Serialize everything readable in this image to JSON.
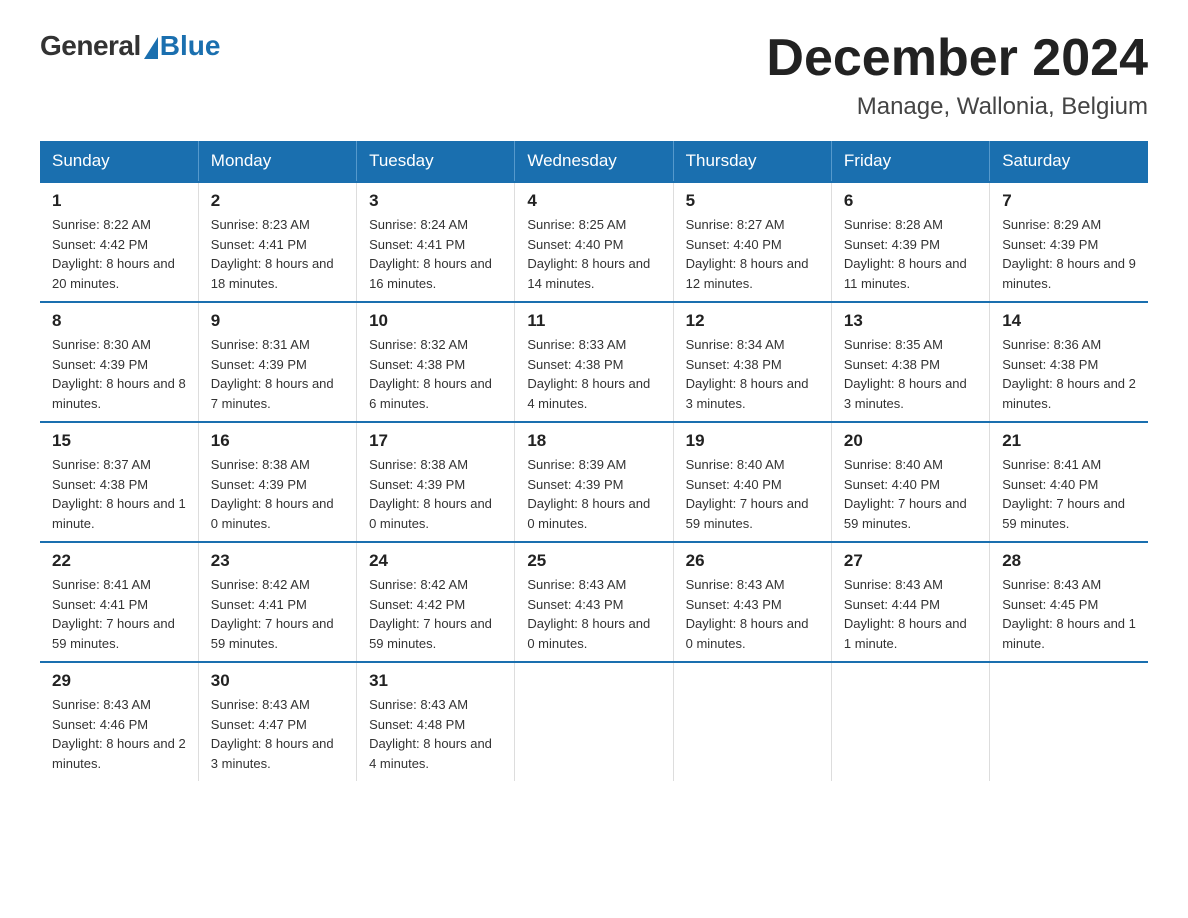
{
  "logo": {
    "general": "General",
    "blue": "Blue"
  },
  "title": "December 2024",
  "location": "Manage, Wallonia, Belgium",
  "days_of_week": [
    "Sunday",
    "Monday",
    "Tuesday",
    "Wednesday",
    "Thursday",
    "Friday",
    "Saturday"
  ],
  "weeks": [
    [
      {
        "day": "1",
        "sunrise": "8:22 AM",
        "sunset": "4:42 PM",
        "daylight": "8 hours and 20 minutes."
      },
      {
        "day": "2",
        "sunrise": "8:23 AM",
        "sunset": "4:41 PM",
        "daylight": "8 hours and 18 minutes."
      },
      {
        "day": "3",
        "sunrise": "8:24 AM",
        "sunset": "4:41 PM",
        "daylight": "8 hours and 16 minutes."
      },
      {
        "day": "4",
        "sunrise": "8:25 AM",
        "sunset": "4:40 PM",
        "daylight": "8 hours and 14 minutes."
      },
      {
        "day": "5",
        "sunrise": "8:27 AM",
        "sunset": "4:40 PM",
        "daylight": "8 hours and 12 minutes."
      },
      {
        "day": "6",
        "sunrise": "8:28 AM",
        "sunset": "4:39 PM",
        "daylight": "8 hours and 11 minutes."
      },
      {
        "day": "7",
        "sunrise": "8:29 AM",
        "sunset": "4:39 PM",
        "daylight": "8 hours and 9 minutes."
      }
    ],
    [
      {
        "day": "8",
        "sunrise": "8:30 AM",
        "sunset": "4:39 PM",
        "daylight": "8 hours and 8 minutes."
      },
      {
        "day": "9",
        "sunrise": "8:31 AM",
        "sunset": "4:39 PM",
        "daylight": "8 hours and 7 minutes."
      },
      {
        "day": "10",
        "sunrise": "8:32 AM",
        "sunset": "4:38 PM",
        "daylight": "8 hours and 6 minutes."
      },
      {
        "day": "11",
        "sunrise": "8:33 AM",
        "sunset": "4:38 PM",
        "daylight": "8 hours and 4 minutes."
      },
      {
        "day": "12",
        "sunrise": "8:34 AM",
        "sunset": "4:38 PM",
        "daylight": "8 hours and 3 minutes."
      },
      {
        "day": "13",
        "sunrise": "8:35 AM",
        "sunset": "4:38 PM",
        "daylight": "8 hours and 3 minutes."
      },
      {
        "day": "14",
        "sunrise": "8:36 AM",
        "sunset": "4:38 PM",
        "daylight": "8 hours and 2 minutes."
      }
    ],
    [
      {
        "day": "15",
        "sunrise": "8:37 AM",
        "sunset": "4:38 PM",
        "daylight": "8 hours and 1 minute."
      },
      {
        "day": "16",
        "sunrise": "8:38 AM",
        "sunset": "4:39 PM",
        "daylight": "8 hours and 0 minutes."
      },
      {
        "day": "17",
        "sunrise": "8:38 AM",
        "sunset": "4:39 PM",
        "daylight": "8 hours and 0 minutes."
      },
      {
        "day": "18",
        "sunrise": "8:39 AM",
        "sunset": "4:39 PM",
        "daylight": "8 hours and 0 minutes."
      },
      {
        "day": "19",
        "sunrise": "8:40 AM",
        "sunset": "4:40 PM",
        "daylight": "7 hours and 59 minutes."
      },
      {
        "day": "20",
        "sunrise": "8:40 AM",
        "sunset": "4:40 PM",
        "daylight": "7 hours and 59 minutes."
      },
      {
        "day": "21",
        "sunrise": "8:41 AM",
        "sunset": "4:40 PM",
        "daylight": "7 hours and 59 minutes."
      }
    ],
    [
      {
        "day": "22",
        "sunrise": "8:41 AM",
        "sunset": "4:41 PM",
        "daylight": "7 hours and 59 minutes."
      },
      {
        "day": "23",
        "sunrise": "8:42 AM",
        "sunset": "4:41 PM",
        "daylight": "7 hours and 59 minutes."
      },
      {
        "day": "24",
        "sunrise": "8:42 AM",
        "sunset": "4:42 PM",
        "daylight": "7 hours and 59 minutes."
      },
      {
        "day": "25",
        "sunrise": "8:43 AM",
        "sunset": "4:43 PM",
        "daylight": "8 hours and 0 minutes."
      },
      {
        "day": "26",
        "sunrise": "8:43 AM",
        "sunset": "4:43 PM",
        "daylight": "8 hours and 0 minutes."
      },
      {
        "day": "27",
        "sunrise": "8:43 AM",
        "sunset": "4:44 PM",
        "daylight": "8 hours and 1 minute."
      },
      {
        "day": "28",
        "sunrise": "8:43 AM",
        "sunset": "4:45 PM",
        "daylight": "8 hours and 1 minute."
      }
    ],
    [
      {
        "day": "29",
        "sunrise": "8:43 AM",
        "sunset": "4:46 PM",
        "daylight": "8 hours and 2 minutes."
      },
      {
        "day": "30",
        "sunrise": "8:43 AM",
        "sunset": "4:47 PM",
        "daylight": "8 hours and 3 minutes."
      },
      {
        "day": "31",
        "sunrise": "8:43 AM",
        "sunset": "4:48 PM",
        "daylight": "8 hours and 4 minutes."
      },
      null,
      null,
      null,
      null
    ]
  ]
}
